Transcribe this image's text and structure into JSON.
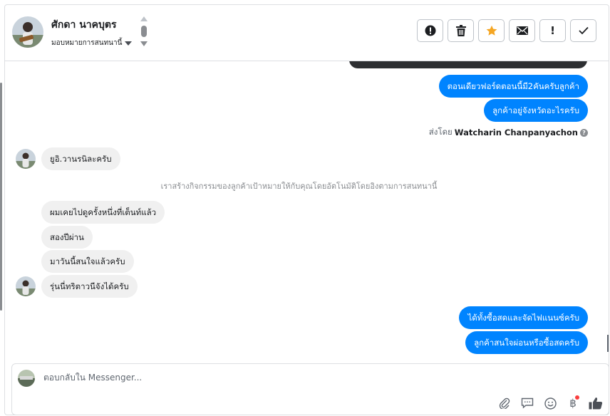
{
  "contact": {
    "name": "ศักดา นาคบุตร",
    "assign_label": "มอบหมายการสนทนานี้"
  },
  "toolbar": {
    "buttons": [
      {
        "name": "report-button",
        "icon": "alert-circle-icon"
      },
      {
        "name": "delete-button",
        "icon": "trash-icon"
      },
      {
        "name": "star-button",
        "icon": "star-icon",
        "color": "#f5a623"
      },
      {
        "name": "mark-unread-button",
        "icon": "envelope-icon"
      },
      {
        "name": "follow-up-button",
        "icon": "exclamation-icon",
        "label": "!"
      },
      {
        "name": "done-button",
        "icon": "check-icon"
      }
    ]
  },
  "messages": {
    "out_1": "ตอนเดียวฟอร์ดตอนนี้มี2คันครับลูกค้า",
    "out_2": "ลูกค้าอยู่จังหวัดอะไรครับ",
    "sent_by_prefix": "ส่งโดย",
    "sent_by_name": "Watcharin Chanpanyachon",
    "in_1": "ยูอิ.วานรนิละครับ",
    "system_note": "เราสร้างกิจกรรมของลูกค้าเป้าหมายให้กับคุณโดยอัตโนมัติโดยอิงตามการสนทนานี้",
    "in_2": "ผมเคยไปดูครั้งหนึ่งที่เต็นท์แล้ว",
    "in_3": "สองปีผ่าน",
    "in_4": "มาวันนี้สนใจแล้วครับ",
    "in_5": "รุ่นนี่ทริตาวนีจังได้ครับ",
    "out_3": "ได้ทั้งซื้อสดและจัดไฟแนนซ์ครับ",
    "out_4": "ลูกค้าสนใจผ่อนหรือซื้อสดครับ"
  },
  "composer": {
    "placeholder": "ตอบกลับใน Messenger...",
    "icons": [
      "paperclip-icon",
      "saved-reply-icon",
      "emoji-icon",
      "baht-payment-icon",
      "thumbs-up-icon"
    ]
  },
  "colors": {
    "outgoing_bubble": "#0084ff",
    "incoming_bubble": "#f0f0f0",
    "star": "#f5a623",
    "notification_dot": "#fa3e3e"
  }
}
